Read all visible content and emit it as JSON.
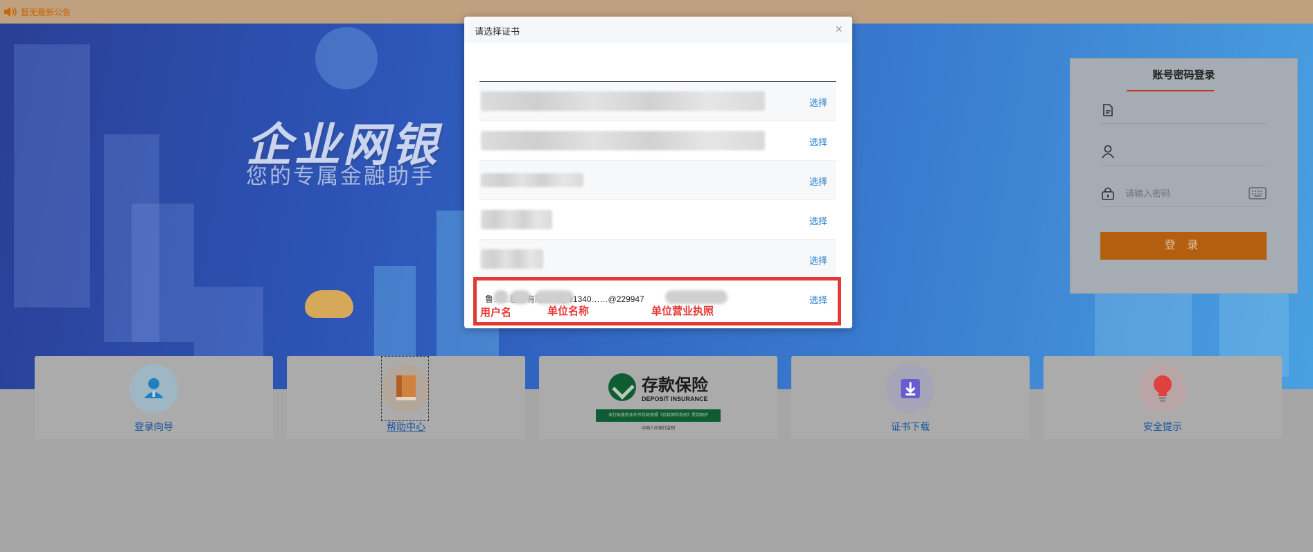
{
  "notice": {
    "text": "暂无最新公告"
  },
  "hero": {
    "title": "企业网银",
    "subtitle": "您的专属金融助手"
  },
  "modal": {
    "title": "请选择证书",
    "select_label": "选择",
    "certificate_text": "鲁……股份有限公司@91340……@229947"
  },
  "annotations": {
    "username": "用户名",
    "company": "单位名称",
    "license": "单位营业执照"
  },
  "login": {
    "title": "账号密码登录",
    "password_placeholder": "请输入密码",
    "login_button": "登 录"
  },
  "cards": {
    "login_guide": "登录向导",
    "help_center": "帮助中心",
    "cert_download": "证书下载",
    "security_tips": "安全提示",
    "deposit_cn": "存款保险",
    "deposit_en": "DEPOSIT INSURANCE",
    "deposit_bar": "本行吸收的本外币存款依照《存款保险条例》受到保护",
    "deposit_foot": "中国人民银行监制"
  }
}
